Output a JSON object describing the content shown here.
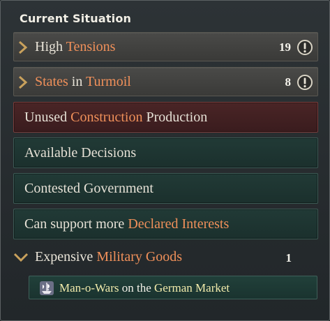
{
  "panel": {
    "title": "Current Situation"
  },
  "summaries": [
    {
      "prefix": "High",
      "highlight": "Tensions",
      "suffix": "",
      "count": "19",
      "icon": "exclamation-circle-icon"
    },
    {
      "prefix": "",
      "highlight": "States",
      "middle": "in",
      "highlight2": "Turmoil",
      "count": "8",
      "icon": "exclamation-circle-icon"
    }
  ],
  "items": [
    {
      "prefix": "Unused",
      "highlight": "Construction",
      "suffix": "Production",
      "style": "warning"
    },
    {
      "label": "Available Decisions"
    },
    {
      "label": "Contested Government"
    },
    {
      "prefix": "Can support more",
      "highlight": "Declared Interests"
    }
  ],
  "expanded": {
    "prefix": "Expensive",
    "highlight": "Military Goods",
    "count": "1",
    "icon": "chevron-down-icon",
    "subitems": [
      {
        "icon": "man-o-war-goods-icon",
        "goods": "Man-o-Wars",
        "middle": "on the",
        "market": "German Market"
      }
    ]
  },
  "colors": {
    "highlight": "#f0905a",
    "gold_text": "#f2ecac",
    "warning_row": "#4a2526",
    "normal_row": "#213a36"
  }
}
